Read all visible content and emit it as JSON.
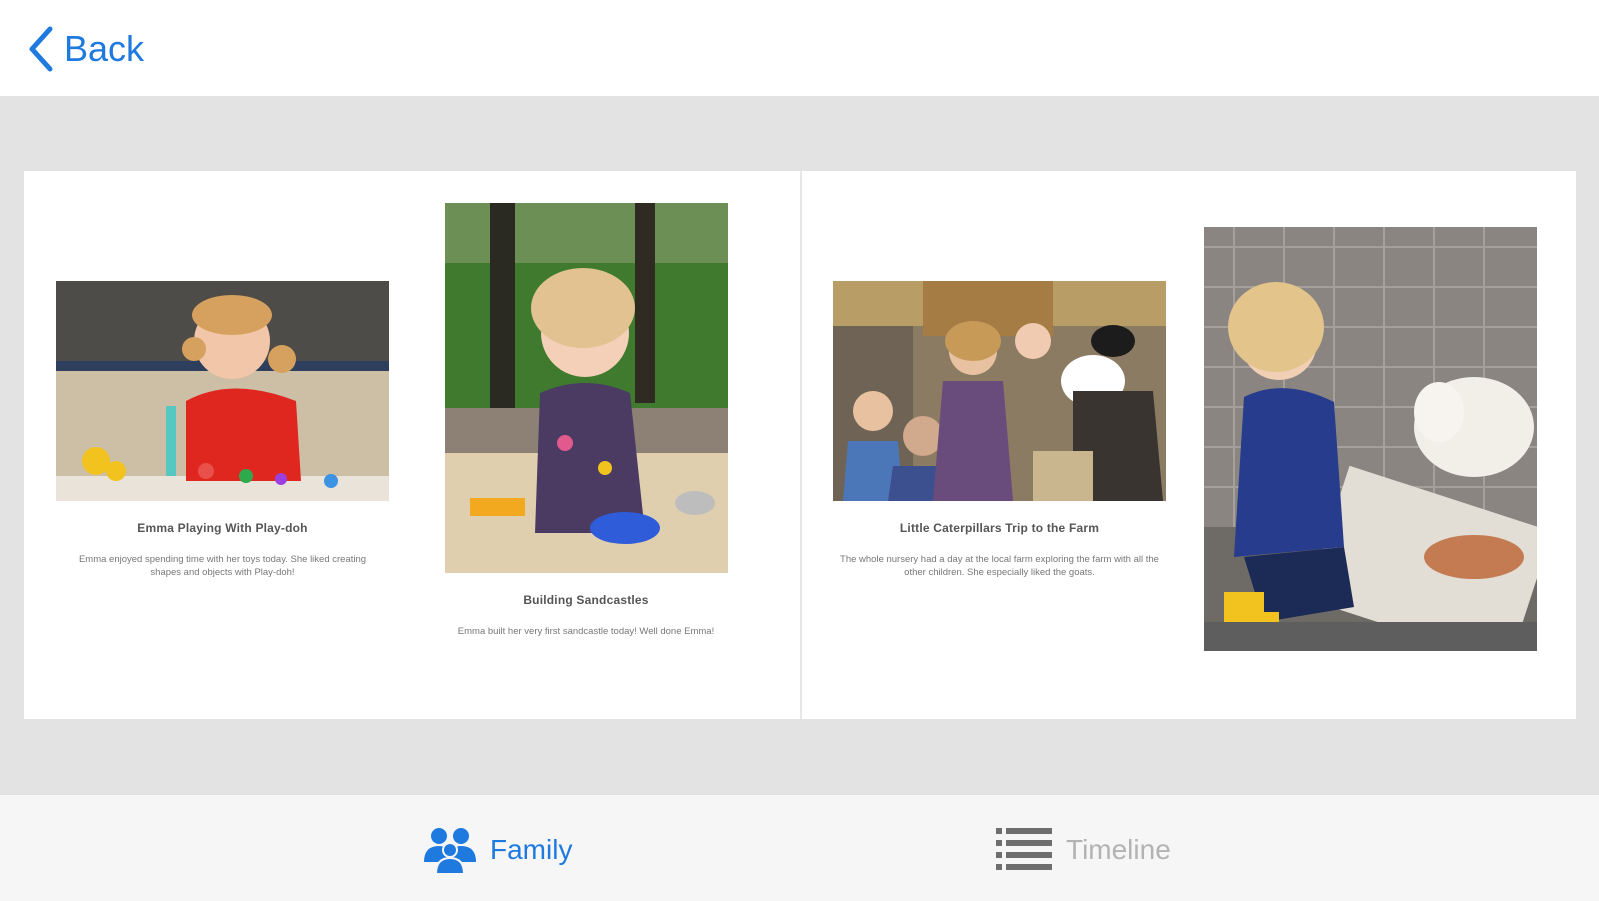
{
  "nav": {
    "back_label": "Back",
    "accent": "#1f7ae0"
  },
  "book": {
    "left_page": [
      {
        "title": "Emma Playing With Play-doh",
        "text": "Emma enjoyed spending time with her toys today. She liked creating shapes and objects with Play-doh!"
      },
      {
        "title": "Building Sandcastles",
        "text": "Emma built her very first sandcastle today! Well done Emma!"
      }
    ],
    "right_page": [
      {
        "title": "Little Caterpillars Trip to the Farm",
        "text": "The whole nursery had a day at the local farm exploring the farm with all the other children. She especially liked the goats."
      }
    ]
  },
  "tabs": [
    {
      "label": "Family",
      "icon": "family-icon",
      "active": true
    },
    {
      "label": "Timeline",
      "icon": "timeline-icon",
      "active": false
    }
  ],
  "colors": {
    "active_tab": "#1f7ae0",
    "inactive_tab": "#b3b3b3",
    "background": "#e3e3e3"
  }
}
